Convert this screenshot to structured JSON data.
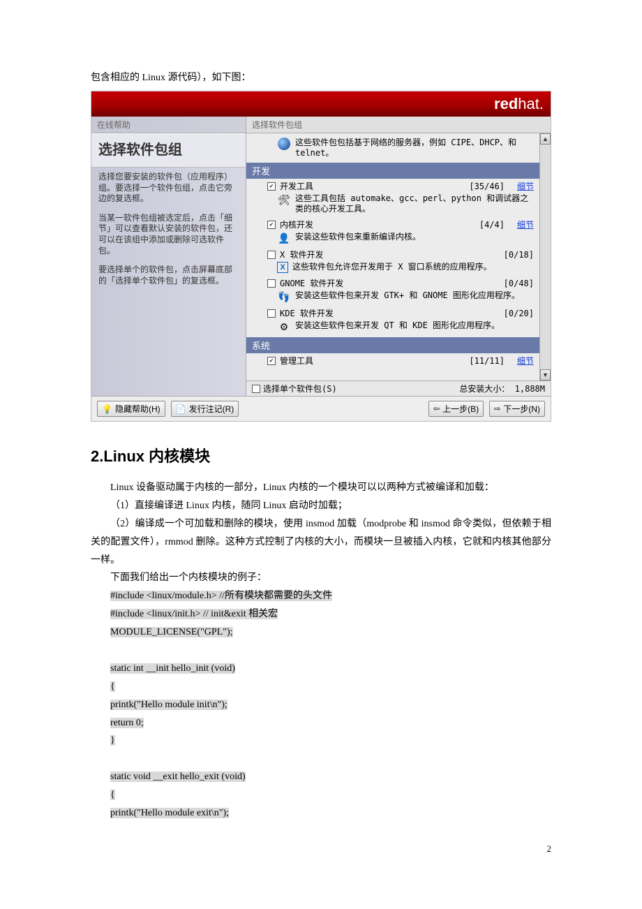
{
  "intro_line": "包含相应的 Linux 源代码），如下图：",
  "installer": {
    "logo_bold": "red",
    "logo_thin": "hat.",
    "sidebar": {
      "tab_label": "在线帮助",
      "title": "选择软件包组",
      "para1": "选择您要安装的软件包（应用程序）组。要选择一个软件包组，点击它旁边的复选框。",
      "para2": "当某一软件包组被选定后，点击「细节」可以查看默认安装的软件包，还可以在该组中添加或删除可选软件包。",
      "para3": "要选择单个的软件包，点击屏幕底部的「选择单个软件包」的复选框。"
    },
    "main": {
      "tab_label": "选择软件包组",
      "top_desc": "这些软件包包括基于网络的服务器，例如 CIPE、DHCP、和 telnet。",
      "cat_dev": "开发",
      "items": [
        {
          "checked": true,
          "label": "开发工具",
          "count": "[35/46]",
          "detail": "细节",
          "desc": "这些工具包括 automake、gcc、perl、python 和调试器之类的核心开发工具。",
          "icon": "🛠"
        },
        {
          "checked": true,
          "label": "内核开发",
          "count": "[4/4]",
          "detail": "细节",
          "desc": "安装这些软件包来重新编译内核。",
          "icon": "👤"
        },
        {
          "checked": false,
          "label": "X 软件开发",
          "count": "[0/18]",
          "detail": "",
          "desc": "这些软件包允许您开发用于 X 窗口系统的应用程序。",
          "icon": "✖"
        },
        {
          "checked": false,
          "label": "GNOME 软件开发",
          "count": "[0/48]",
          "detail": "",
          "desc": "安装这些软件包来开发 GTK+ 和 GNOME 图形化应用程序。",
          "icon": "👣"
        },
        {
          "checked": false,
          "label": "KDE 软件开发",
          "count": "[0/20]",
          "detail": "",
          "desc": "安装这些软件包来开发 QT 和 KDE 图形化应用程序。",
          "icon": "⚙"
        }
      ],
      "cat_sys": "系统",
      "sys_item": {
        "checked": true,
        "label": "管理工具",
        "count": "[11/11]",
        "detail": "细节"
      },
      "footer_check_label": "选择单个软件包(S)",
      "footer_total_label": "总安装大小：",
      "footer_total_value": "1,888M"
    },
    "buttons": {
      "hide_help": "隐藏帮助(H)",
      "release_notes": "发行注记(R)",
      "back": "上一步(B)",
      "next": "下一步(N)"
    }
  },
  "heading2": "2.Linux 内核模块",
  "body": {
    "p1": "Linux 设备驱动属于内核的一部分，Linux 内核的一个模块可以以两种方式被编译和加载：",
    "p2": "（1）直接编译进 Linux 内核，随同 Linux 启动时加载；",
    "p3": "（2）编译成一个可加载和删除的模块，使用 insmod 加载（modprobe 和 insmod 命令类似，但依赖于相关的配置文件），rmmod 删除。这种方式控制了内核的大小，而模块一旦被插入内核，它就和内核其他部分一样。",
    "p4": "下面我们给出一个内核模块的例子："
  },
  "code": {
    "l1": "#include <linux/module.h>   //所有模块都需要的头文件",
    "l2": "#include <linux/init.h>         // init&exit 相关宏",
    "l3": "MODULE_LICENSE(\"GPL\");",
    "l4": "",
    "l5": "static int __init hello_init (void)",
    "l6": "{",
    "l7": "  printk(\"Hello module init\\n\");",
    "l8": "  return 0;",
    "l9": "}",
    "l10": "",
    "l11": "static void __exit hello_exit (void)",
    "l12": "{",
    "l13": "  printk(\"Hello module exit\\n\");"
  },
  "pagenum": "2"
}
